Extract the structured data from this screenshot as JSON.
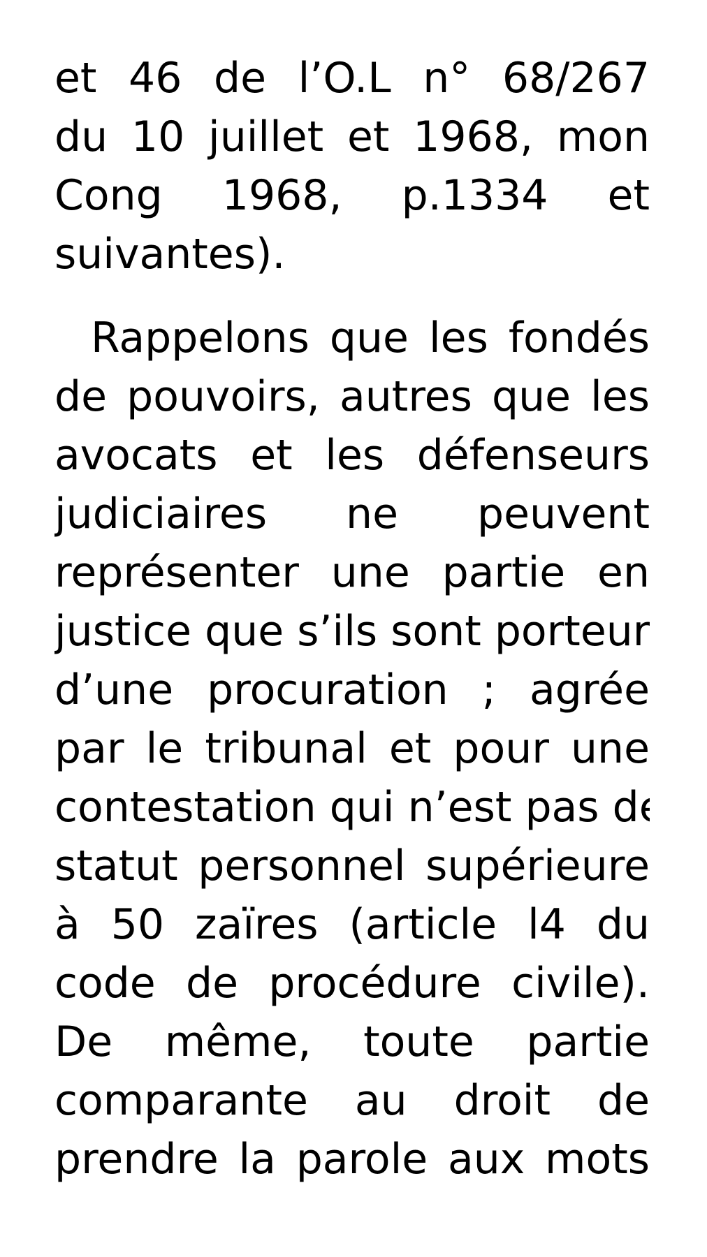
{
  "document": {
    "blocks": [
      {
        "lines": [
          "et 46 de l’O.L n° 68/267",
          "du 10 juillet et 1968, mon",
          "Cong 1968, p.1334 et",
          "suivantes)."
        ]
      },
      {
        "lines": [
          "Rappelons que  les fondés",
          "de pouvoirs, autres que les",
          "avocats et les défenseurs",
          "judiciaires ne peuvent",
          "représenter une partie en",
          "justice que s’ils sont porteurs",
          "d’une procuration ; agrée",
          "par le tribunal et pour une",
          "contestation qui n’est pas de",
          "statut personnel supérieure",
          "à 50 zaïres (article l4 du",
          "code de procédure civile).",
          "De même, toute partie",
          "comparante au droit de",
          "prendre la parole aux mots"
        ]
      }
    ]
  }
}
